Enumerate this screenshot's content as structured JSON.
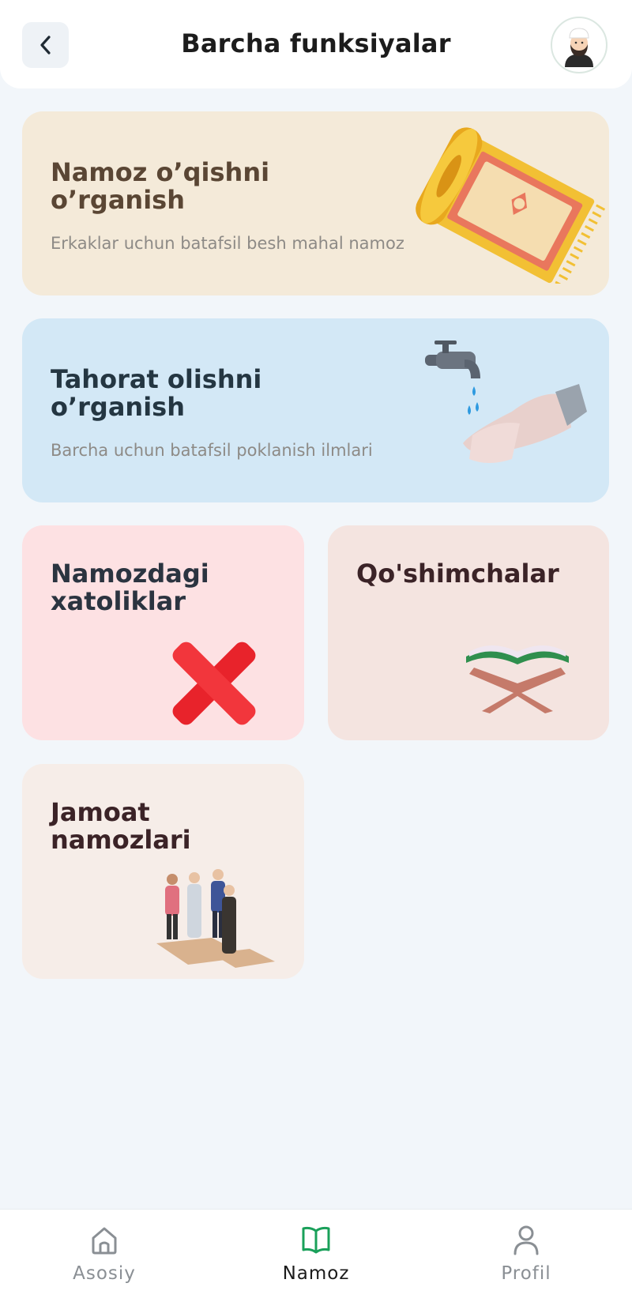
{
  "header": {
    "title": "Barcha funksiyalar",
    "back_icon": "chevron-left-icon",
    "avatar_icon": "user-avatar-icon"
  },
  "cards": [
    {
      "id": "namoz",
      "title_lines": [
        "Namoz o’qishni",
        "o’rganish"
      ],
      "subtitle": "Erkaklar uchun batafsil besh mahal namoz",
      "icon": "prayer-rug-icon",
      "bg": "#f4ead9",
      "title_color": "#5a4634"
    },
    {
      "id": "tahorat",
      "title_lines": [
        "Tahorat olishni",
        "o’rganish"
      ],
      "subtitle": "Barcha uchun batafsil poklanish ilmlari",
      "icon": "faucet-hands-icon",
      "bg": "#d3e8f6",
      "title_color": "#243642"
    },
    {
      "id": "xatolar",
      "title_lines": [
        "Namozdagi",
        "xatoliklar"
      ],
      "icon": "red-x-icon",
      "bg": "#fde1e3",
      "title_color": "#2b3440"
    },
    {
      "id": "qoshimcha",
      "title_lines": [
        "Qo'shimchalar"
      ],
      "icon": "quran-stand-icon",
      "bg": "#f4e4e0",
      "title_color": "#3b2327"
    },
    {
      "id": "jamoat",
      "title_lines": [
        "Jamoat",
        "namozlari"
      ],
      "icon": "congregation-icon",
      "bg": "#f6ede8",
      "title_color": "#3b2327"
    }
  ],
  "nav": [
    {
      "label": "Asosiy",
      "icon": "home-icon",
      "active": false
    },
    {
      "label": "Namoz",
      "icon": "book-open-icon",
      "active": true
    },
    {
      "label": "Profil",
      "icon": "user-icon",
      "active": false
    }
  ],
  "colors": {
    "background": "#f2f6fa",
    "accent_green": "#1aa05a",
    "nav_inactive": "#8a8f94",
    "nav_active_text": "#1b1b1b"
  }
}
